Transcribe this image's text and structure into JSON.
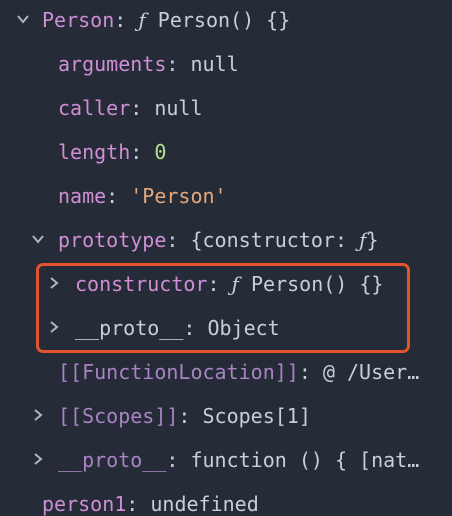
{
  "colors": {
    "background": "#262b38",
    "key": "#cf8ed6",
    "text": "#c8ced9",
    "number": "#b5e08a",
    "string": "#e7a77a",
    "highlight": "#e2542f"
  },
  "rows": [
    {
      "key": "Person",
      "sep": ":",
      "f": "ƒ",
      "value": "Person() {}",
      "toggle": "expanded"
    },
    {
      "key": "arguments",
      "sep": ":",
      "value": "null"
    },
    {
      "key": "caller",
      "sep": ":",
      "value": "null"
    },
    {
      "key": "length",
      "sep": ":",
      "value": "0"
    },
    {
      "key": "name",
      "sep": ":",
      "value": "'Person'"
    },
    {
      "key": "prototype",
      "sep": ":",
      "value": "{constructor: ",
      "f": "ƒ",
      "value_end": "}",
      "toggle": "expanded"
    },
    {
      "key": "constructor",
      "sep": ":",
      "f": "ƒ",
      "value": "Person() {}",
      "toggle": "collapsed"
    },
    {
      "key": "__proto__",
      "sep": ":",
      "value": "Object",
      "toggle": "collapsed"
    },
    {
      "key": "[[FunctionLocation]]",
      "sep": ":",
      "value": "@ /User…"
    },
    {
      "key": "[[Scopes]]",
      "sep": ":",
      "value": "Scopes[1]",
      "toggle": "collapsed"
    },
    {
      "key": "__proto__",
      "sep": ":",
      "value": "function () { [nat…",
      "toggle": "collapsed"
    },
    {
      "key": "person1",
      "sep": ":",
      "value": "undefined"
    }
  ]
}
